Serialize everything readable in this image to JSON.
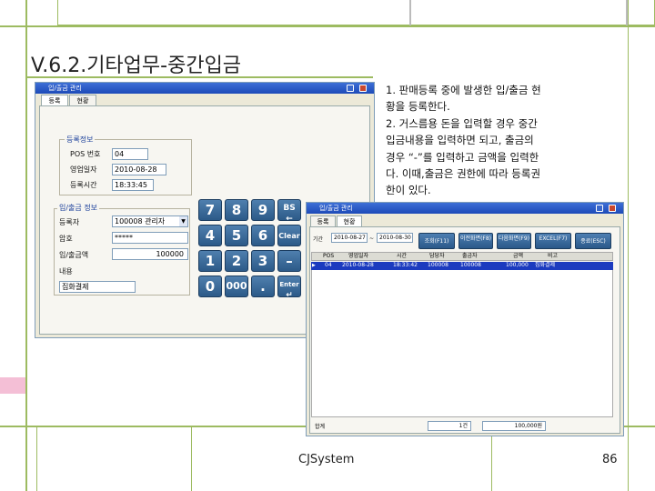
{
  "slide": {
    "title": "V.6.2.기타업무-중간입금",
    "description": [
      "1. 판매등록 중에 발생한 입/출금 현",
      "황을 등록한다.",
      "2. 거스름용 돈을 입력할 경우 중간",
      "입금내용을 입력하면 되고, 출금의",
      "경우 “-”를 입력하고 금액을 입력한",
      "다. 이때,출금은 권한에 따라 등록권",
      "한이 있다."
    ],
    "footer": "CJSystem",
    "page_number": "86"
  },
  "left_window": {
    "title": "입/출금 관리",
    "tabs": [
      "등록",
      "현황"
    ],
    "register_info_legend": "등록정보",
    "pos_label": "POS 번호",
    "pos_value": "04",
    "biz_date_label": "영업일자",
    "biz_date_value": "2010-08-28",
    "reg_time_label": "등록시간",
    "reg_time_value": "18:33:45",
    "cash_info_legend": "입/출금 정보",
    "registrant_label": "등록자",
    "registrant_value": "100008 관리자",
    "password_label": "암호",
    "password_value": "*****",
    "amount_label": "입/출금액",
    "amount_value": "100000",
    "content_label": "내용",
    "content_value": "집화결제",
    "keypad": [
      [
        "7",
        "8",
        "9",
        "BS"
      ],
      [
        "4",
        "5",
        "6",
        "Clear"
      ],
      [
        "1",
        "2",
        "3",
        "–"
      ],
      [
        "0",
        "000",
        ".",
        "Enter"
      ]
    ]
  },
  "right_window": {
    "title": "입/출금 관리",
    "tabs": [
      "등록",
      "현황"
    ],
    "period_label": "기간",
    "date_from": "2010-08-27",
    "date_to": "2010-08-30",
    "buttons": [
      "조회(F11)",
      "이전화면(F8)",
      "다음화면(F9)",
      "EXCEL(F7)",
      "종료(ESC)"
    ],
    "columns": [
      "POS",
      "영업일자",
      "시간",
      "담당자",
      "출금자",
      "금액",
      "비고"
    ],
    "rows": [
      [
        "04",
        "2010-08-28",
        "18:33:42",
        "100008",
        "100008",
        "100,000",
        "집화결제"
      ]
    ],
    "total_label": "합계",
    "total_count": "1건",
    "total_amount": "100,000원"
  },
  "colors": {
    "green_line": "#9dbb61",
    "pink_block": "#f4bfd6",
    "window_title": "#2b5ec7",
    "selected_row": "#1c3bbf",
    "keypad": "#3a6a9a"
  }
}
